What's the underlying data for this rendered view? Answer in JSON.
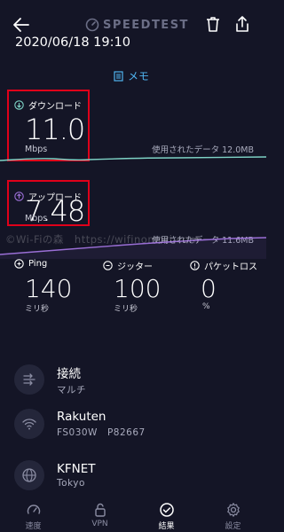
{
  "header": {
    "app_name": "SPEEDTEST",
    "datetime": "2020/06/18 19:10",
    "memo_label": "メモ"
  },
  "download": {
    "label": "ダウンロード",
    "value": "11.0",
    "unit": "Mbps",
    "used_data": "使用されたデータ 12.0MB"
  },
  "upload": {
    "label": "アップロード",
    "value": "7.48",
    "unit": "Mbps",
    "used_data": "使用されたデータ 11.6MB"
  },
  "watermark": "©Wi-Fiの森　https://wifinomori.com",
  "stats": {
    "ping": {
      "label": "Ping",
      "value": "140",
      "unit": "ミリ秒"
    },
    "jitter": {
      "label": "ジッター",
      "value": "100",
      "unit": "ミリ秒"
    },
    "packet_loss": {
      "label": "パケットロス",
      "value": "0",
      "unit": "%"
    }
  },
  "connections": {
    "label": "接続",
    "value": "マルチ"
  },
  "server": {
    "name": "Rakuten",
    "detail": "FS030W　P82667"
  },
  "provider": {
    "name": "KFNET",
    "location": "Tokyo"
  },
  "nav": [
    {
      "label": "速度",
      "icon": "speedometer-icon"
    },
    {
      "label": "VPN",
      "icon": "lock-icon"
    },
    {
      "label": "結果",
      "icon": "check-circle-icon"
    },
    {
      "label": "設定",
      "icon": "gear-icon"
    }
  ],
  "colors": {
    "background": "#141526",
    "download_accent": "#7ed3c6",
    "upload_accent": "#9b6fd6",
    "highlight_box": "#e0001a",
    "memo_link": "#4fb3ef"
  }
}
